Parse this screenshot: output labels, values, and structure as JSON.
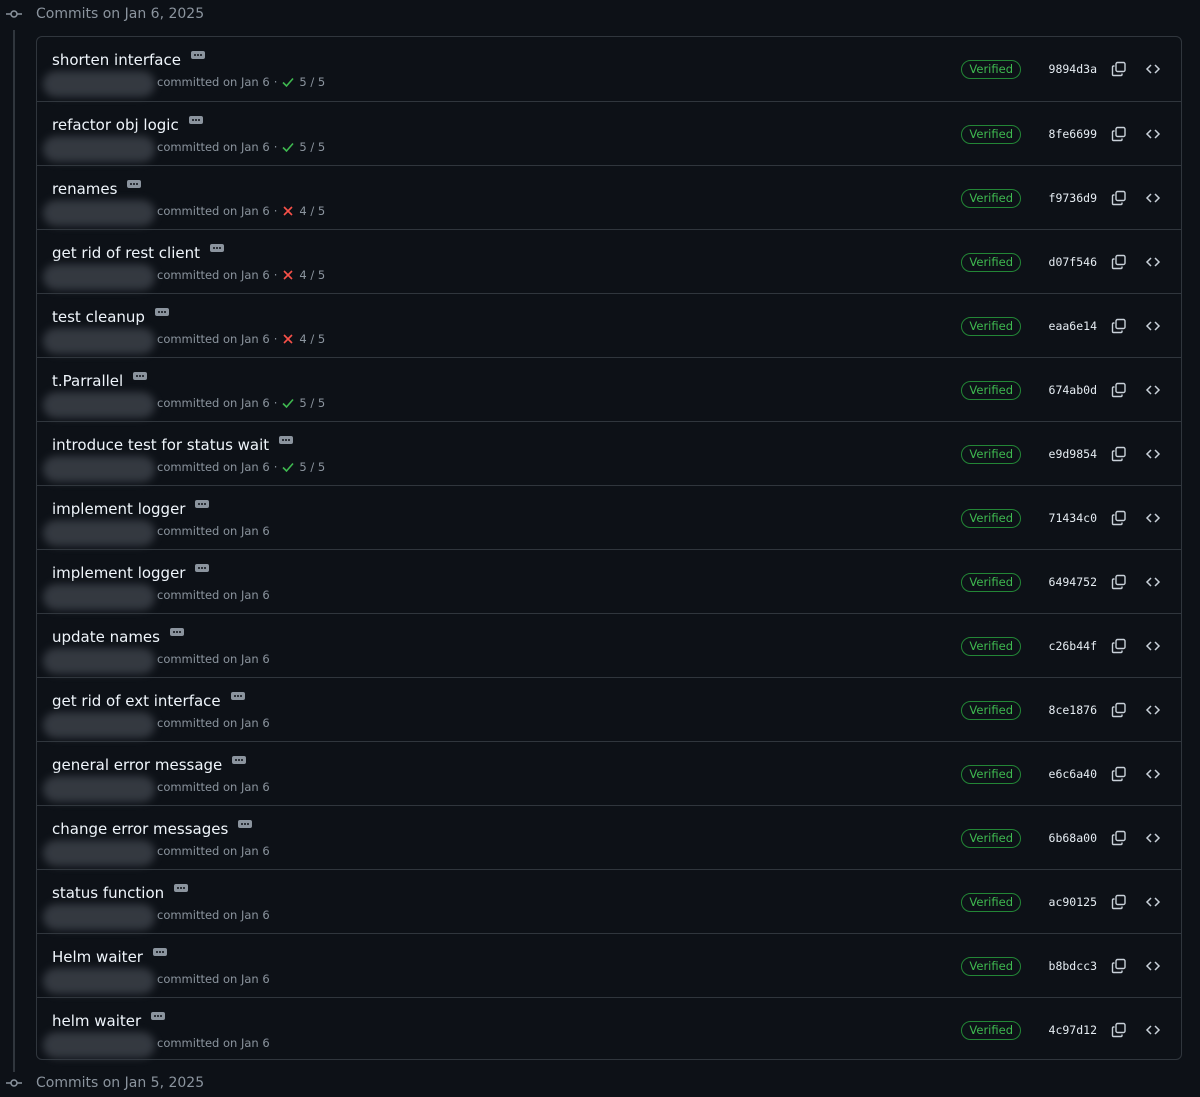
{
  "groups": [
    {
      "label": "Commits on Jan 6, 2025"
    },
    {
      "label": "Commits on Jan 5, 2025"
    }
  ],
  "commits": [
    {
      "title": "shorten interface",
      "meta": "committed on Jan 6",
      "status": "success",
      "checks": "5 / 5",
      "verified": "Verified",
      "sha": "9894d3a"
    },
    {
      "title": "refactor obj logic",
      "meta": "committed on Jan 6",
      "status": "success",
      "checks": "5 / 5",
      "verified": "Verified",
      "sha": "8fe6699"
    },
    {
      "title": "renames",
      "meta": "committed on Jan 6",
      "status": "failure",
      "checks": "4 / 5",
      "verified": "Verified",
      "sha": "f9736d9"
    },
    {
      "title": "get rid of rest client",
      "meta": "committed on Jan 6",
      "status": "failure",
      "checks": "4 / 5",
      "verified": "Verified",
      "sha": "d07f546"
    },
    {
      "title": "test cleanup",
      "meta": "committed on Jan 6",
      "status": "failure",
      "checks": "4 / 5",
      "verified": "Verified",
      "sha": "eaa6e14"
    },
    {
      "title": "t.Parrallel",
      "meta": "committed on Jan 6",
      "status": "success",
      "checks": "5 / 5",
      "verified": "Verified",
      "sha": "674ab0d"
    },
    {
      "title": "introduce test for status wait",
      "meta": "committed on Jan 6",
      "status": "success",
      "checks": "5 / 5",
      "verified": "Verified",
      "sha": "e9d9854"
    },
    {
      "title": "implement logger",
      "meta": "committed on Jan 6",
      "status": "none",
      "checks": "",
      "verified": "Verified",
      "sha": "71434c0"
    },
    {
      "title": "implement logger",
      "meta": "committed on Jan 6",
      "status": "none",
      "checks": "",
      "verified": "Verified",
      "sha": "6494752"
    },
    {
      "title": "update names",
      "meta": "committed on Jan 6",
      "status": "none",
      "checks": "",
      "verified": "Verified",
      "sha": "c26b44f"
    },
    {
      "title": "get rid of ext interface",
      "meta": "committed on Jan 6",
      "status": "none",
      "checks": "",
      "verified": "Verified",
      "sha": "8ce1876"
    },
    {
      "title": "general error message",
      "meta": "committed on Jan 6",
      "status": "none",
      "checks": "",
      "verified": "Verified",
      "sha": "e6c6a40"
    },
    {
      "title": "change error messages",
      "meta": "committed on Jan 6",
      "status": "none",
      "checks": "",
      "verified": "Verified",
      "sha": "6b68a00"
    },
    {
      "title": "status function",
      "meta": "committed on Jan 6",
      "status": "none",
      "checks": "",
      "verified": "Verified",
      "sha": "ac90125"
    },
    {
      "title": "Helm waiter",
      "meta": "committed on Jan 6",
      "status": "none",
      "checks": "",
      "verified": "Verified",
      "sha": "b8bdcc3"
    },
    {
      "title": "helm waiter",
      "meta": "committed on Jan 6",
      "status": "none",
      "checks": "",
      "verified": "Verified",
      "sha": "4c97d12"
    }
  ],
  "icons": {
    "commit": "git-commit-icon",
    "ellipsis": "ellipsis-icon",
    "success": "check-icon",
    "failure": "x-icon",
    "copy": "copy-icon",
    "browse": "code-icon"
  },
  "colors": {
    "background": "#0d1117",
    "border": "#30363d",
    "success": "#3fb950",
    "failure": "#f85149",
    "muted": "#8b949e"
  }
}
